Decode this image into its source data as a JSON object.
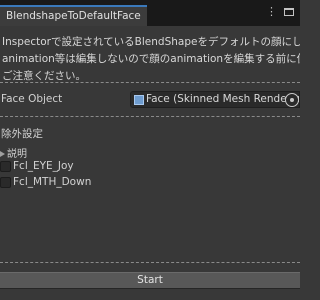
{
  "window": {
    "tab_title": "BlendshapeToDefaultFace",
    "menu_icon": "kebab-menu-icon",
    "maximize_icon": "maximize-icon"
  },
  "description": {
    "line1": "Inspectorで設定されているBlendShapeをデフォルトの顔にします。",
    "line2": "animation等は編集しないので顔のanimationを編集する前に使うよう",
    "line3": "ご注意ください。"
  },
  "face_object": {
    "label": "Face Object",
    "value": "Face (Skinned Mesh Renderer)",
    "field_icon": "skinned-mesh-renderer-icon",
    "picker_icon": "object-picker-icon"
  },
  "exclusions": {
    "title": "除外設定",
    "foldout_label": "説明",
    "items": [
      {
        "label": "Fcl_EYE_Joy",
        "checked": false
      },
      {
        "label": "Fcl_MTH_Down",
        "checked": false
      }
    ]
  },
  "start_button": {
    "label": "Start"
  }
}
